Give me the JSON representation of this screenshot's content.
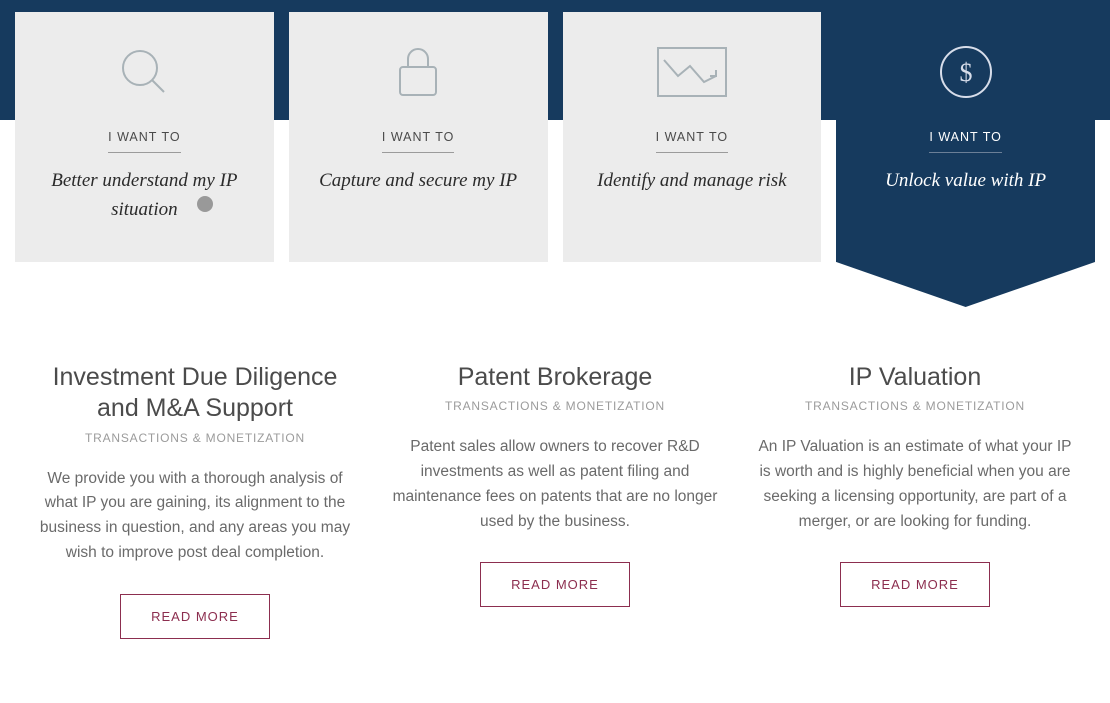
{
  "cards": [
    {
      "eyebrow": "I WANT TO",
      "title": "Better understand my IP situation"
    },
    {
      "eyebrow": "I WANT TO",
      "title": "Capture and secure my IP"
    },
    {
      "eyebrow": "I WANT TO",
      "title": "Identify and manage risk"
    },
    {
      "eyebrow": "I WANT TO",
      "title": "Unlock value with IP"
    }
  ],
  "services": [
    {
      "title": "Investment Due Diligence and M&A Support",
      "category": "TRANSACTIONS & MONETIZATION",
      "description": "We provide you with a thorough analysis of what IP you are gaining, its alignment to the business in question, and any areas you may wish to improve post deal completion.",
      "button": "READ MORE"
    },
    {
      "title": "Patent Brokerage",
      "category": "TRANSACTIONS & MONETIZATION",
      "description": "Patent sales allow owners to recover R&D investments as well as patent filing and maintenance fees on patents that are no longer used by the business.",
      "button": "READ MORE"
    },
    {
      "title": "IP Valuation",
      "category": "TRANSACTIONS & MONETIZATION",
      "description": "An IP Valuation is an estimate of what your IP is worth and is highly beneficial when you are seeking a licensing opportunity, are part of a merger, or are looking for funding.",
      "button": "READ MORE"
    }
  ]
}
